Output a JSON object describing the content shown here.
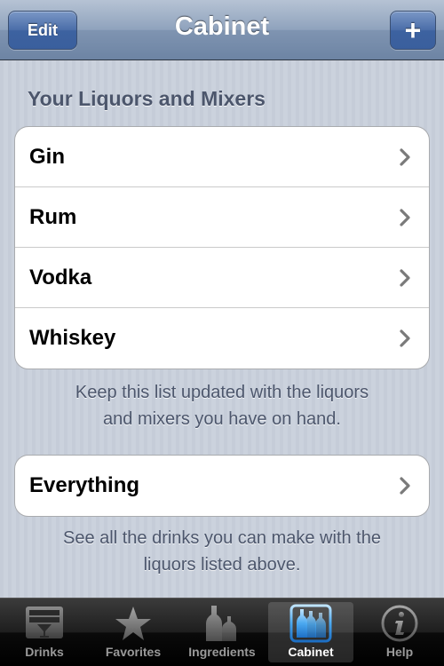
{
  "navbar": {
    "title": "Cabinet",
    "edit_label": "Edit",
    "add_label": "+"
  },
  "section": {
    "header": "Your Liquors and Mixers",
    "items": [
      {
        "label": "Gin"
      },
      {
        "label": "Rum"
      },
      {
        "label": "Vodka"
      },
      {
        "label": "Whiskey"
      }
    ],
    "footer_line1": "Keep this list updated with the liquors",
    "footer_line2": "and mixers you have on hand."
  },
  "everything": {
    "label": "Everything",
    "footer_line1": "See all the drinks you can make with the",
    "footer_line2": "liquors listed above."
  },
  "tabbar": {
    "tabs": [
      {
        "label": "Drinks",
        "icon": "drinks-icon",
        "selected": false
      },
      {
        "label": "Favorites",
        "icon": "star-icon",
        "selected": false
      },
      {
        "label": "Ingredients",
        "icon": "bottles-icon",
        "selected": false
      },
      {
        "label": "Cabinet",
        "icon": "cabinet-bottles-icon",
        "selected": true
      },
      {
        "label": "Help",
        "icon": "info-icon",
        "selected": false
      }
    ]
  },
  "colors": {
    "navbar": "#7f94b1",
    "accent_selected_icon": "#4aa8f0",
    "section_text": "#4c566c"
  }
}
